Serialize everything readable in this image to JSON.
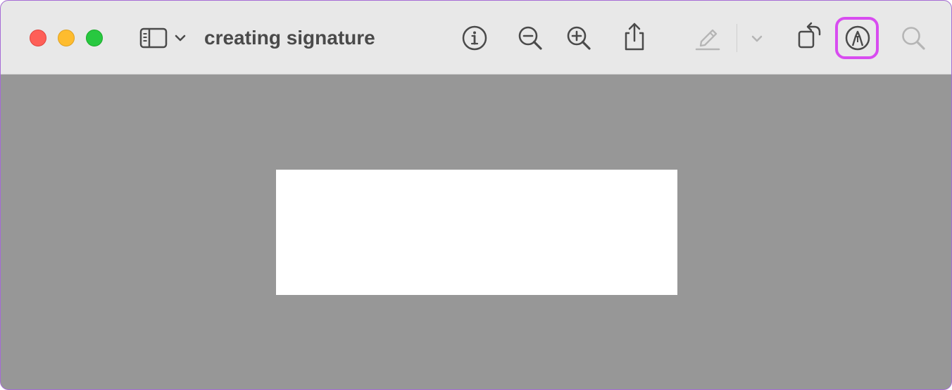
{
  "window": {
    "title": "creating signature"
  },
  "toolbar": {
    "icons": {
      "close": "close-window",
      "minimize": "minimize-window",
      "zoom": "zoom-window",
      "sidebar": "sidebar-icon",
      "sidebar_menu": "chevron-down-icon",
      "info": "info-icon",
      "zoom_out": "zoom-out-icon",
      "zoom_in": "zoom-in-icon",
      "share": "share-icon",
      "highlight": "highlighter-icon",
      "highlight_menu": "chevron-down-icon",
      "rotate": "rotate-icon",
      "markup": "markup-pen-icon",
      "search": "search-icon"
    },
    "highlighted_button": "markup",
    "colors": {
      "toolbar_bg": "#e8e8e8",
      "content_bg": "#979797",
      "highlight_border": "#d84cf0",
      "close": "#fe5f57",
      "minimize": "#febc2e",
      "zoom": "#28c840",
      "icon": "#4a4a4a",
      "icon_disabled": "#b5b5b5"
    }
  },
  "document": {
    "page_color": "#ffffff"
  }
}
